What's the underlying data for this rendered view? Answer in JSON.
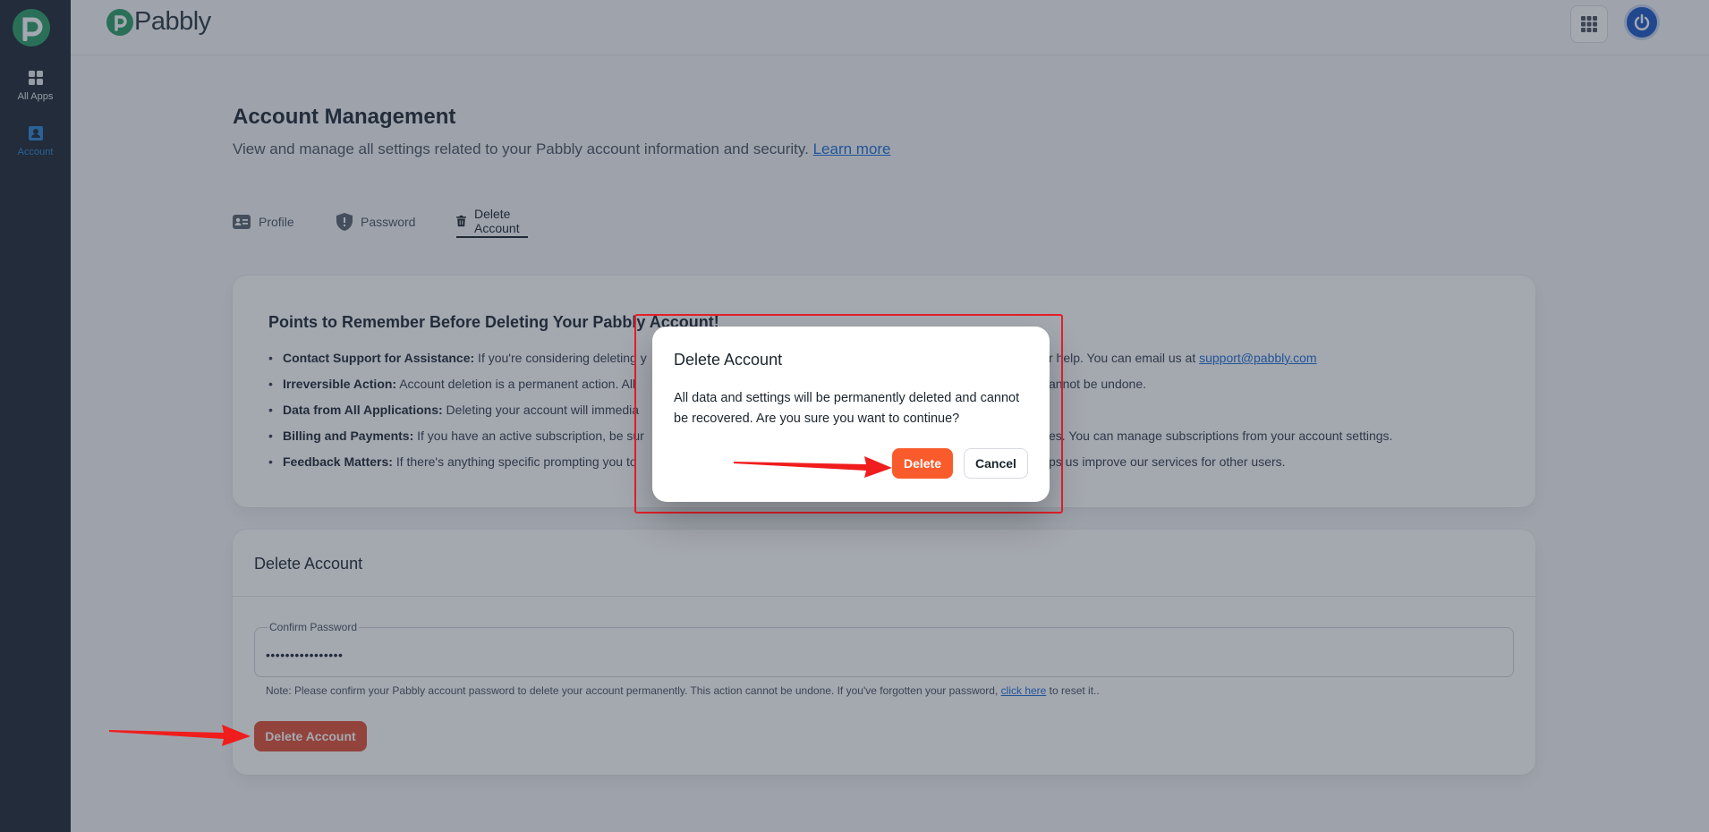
{
  "sidebar": {
    "items": [
      {
        "label": "All Apps",
        "icon": "grid-icon"
      },
      {
        "label": "Account",
        "icon": "account-icon",
        "active": true
      }
    ]
  },
  "topbar": {
    "brand": "Pabbly",
    "apps_icon": "apps-grid-icon",
    "avatar_icon": "power-icon"
  },
  "page": {
    "title": "Account Management",
    "description": "View and manage all settings related to your Pabbly account information and security. ",
    "learn_more": "Learn more"
  },
  "tabs": [
    {
      "label": "Profile",
      "icon": "id-card-icon"
    },
    {
      "label": "Password",
      "icon": "shield-icon"
    },
    {
      "label": "Delete Account",
      "icon": "trash-icon",
      "active": true
    }
  ],
  "points": {
    "title": "Points to Remember Before Deleting Your Pabbly Account!",
    "items": [
      {
        "label": "Contact Support for Assistance:",
        "text": " If you're considering deleting y",
        "text_after": "r help. You can email us at ",
        "link": "support@pabbly.com"
      },
      {
        "label": "Irreversible Action:",
        "text": " Account deletion is a permanent action. All ",
        "text_after": "annot be undone."
      },
      {
        "label": "Data from All Applications:",
        "text": " Deleting your account will immedia",
        "text_after": ""
      },
      {
        "label": "Billing and Payments:",
        "text": " If you have an active subscription, be sur",
        "text_after": "es. You can manage subscriptions from your account settings."
      },
      {
        "label": "Feedback Matters:",
        "text": " If there's anything specific prompting you to",
        "text_after": "ps us improve our services for other users."
      }
    ]
  },
  "delete_card": {
    "title": "Delete Account",
    "password_label": "Confirm Password",
    "password_value": "••••••••••••••••",
    "note_before": "Note: Please confirm your Pabbly account password to delete your account permanently. This action cannot be undone. If you've forgotten your password, ",
    "note_link": "click here",
    "note_after": " to reset it..",
    "button": "Delete Account"
  },
  "modal": {
    "title": "Delete Account",
    "body": "All data and settings will be permanently deleted and cannot be recovered. Are you sure you want to continue?",
    "confirm": "Delete",
    "cancel": "Cancel"
  },
  "colors": {
    "sidebar_bg": "#1f2a36",
    "brand_green": "#2e9f6a",
    "accent_blue": "#2d87d6",
    "danger": "#fa5b2c",
    "annotation_red": "#e5202a"
  }
}
